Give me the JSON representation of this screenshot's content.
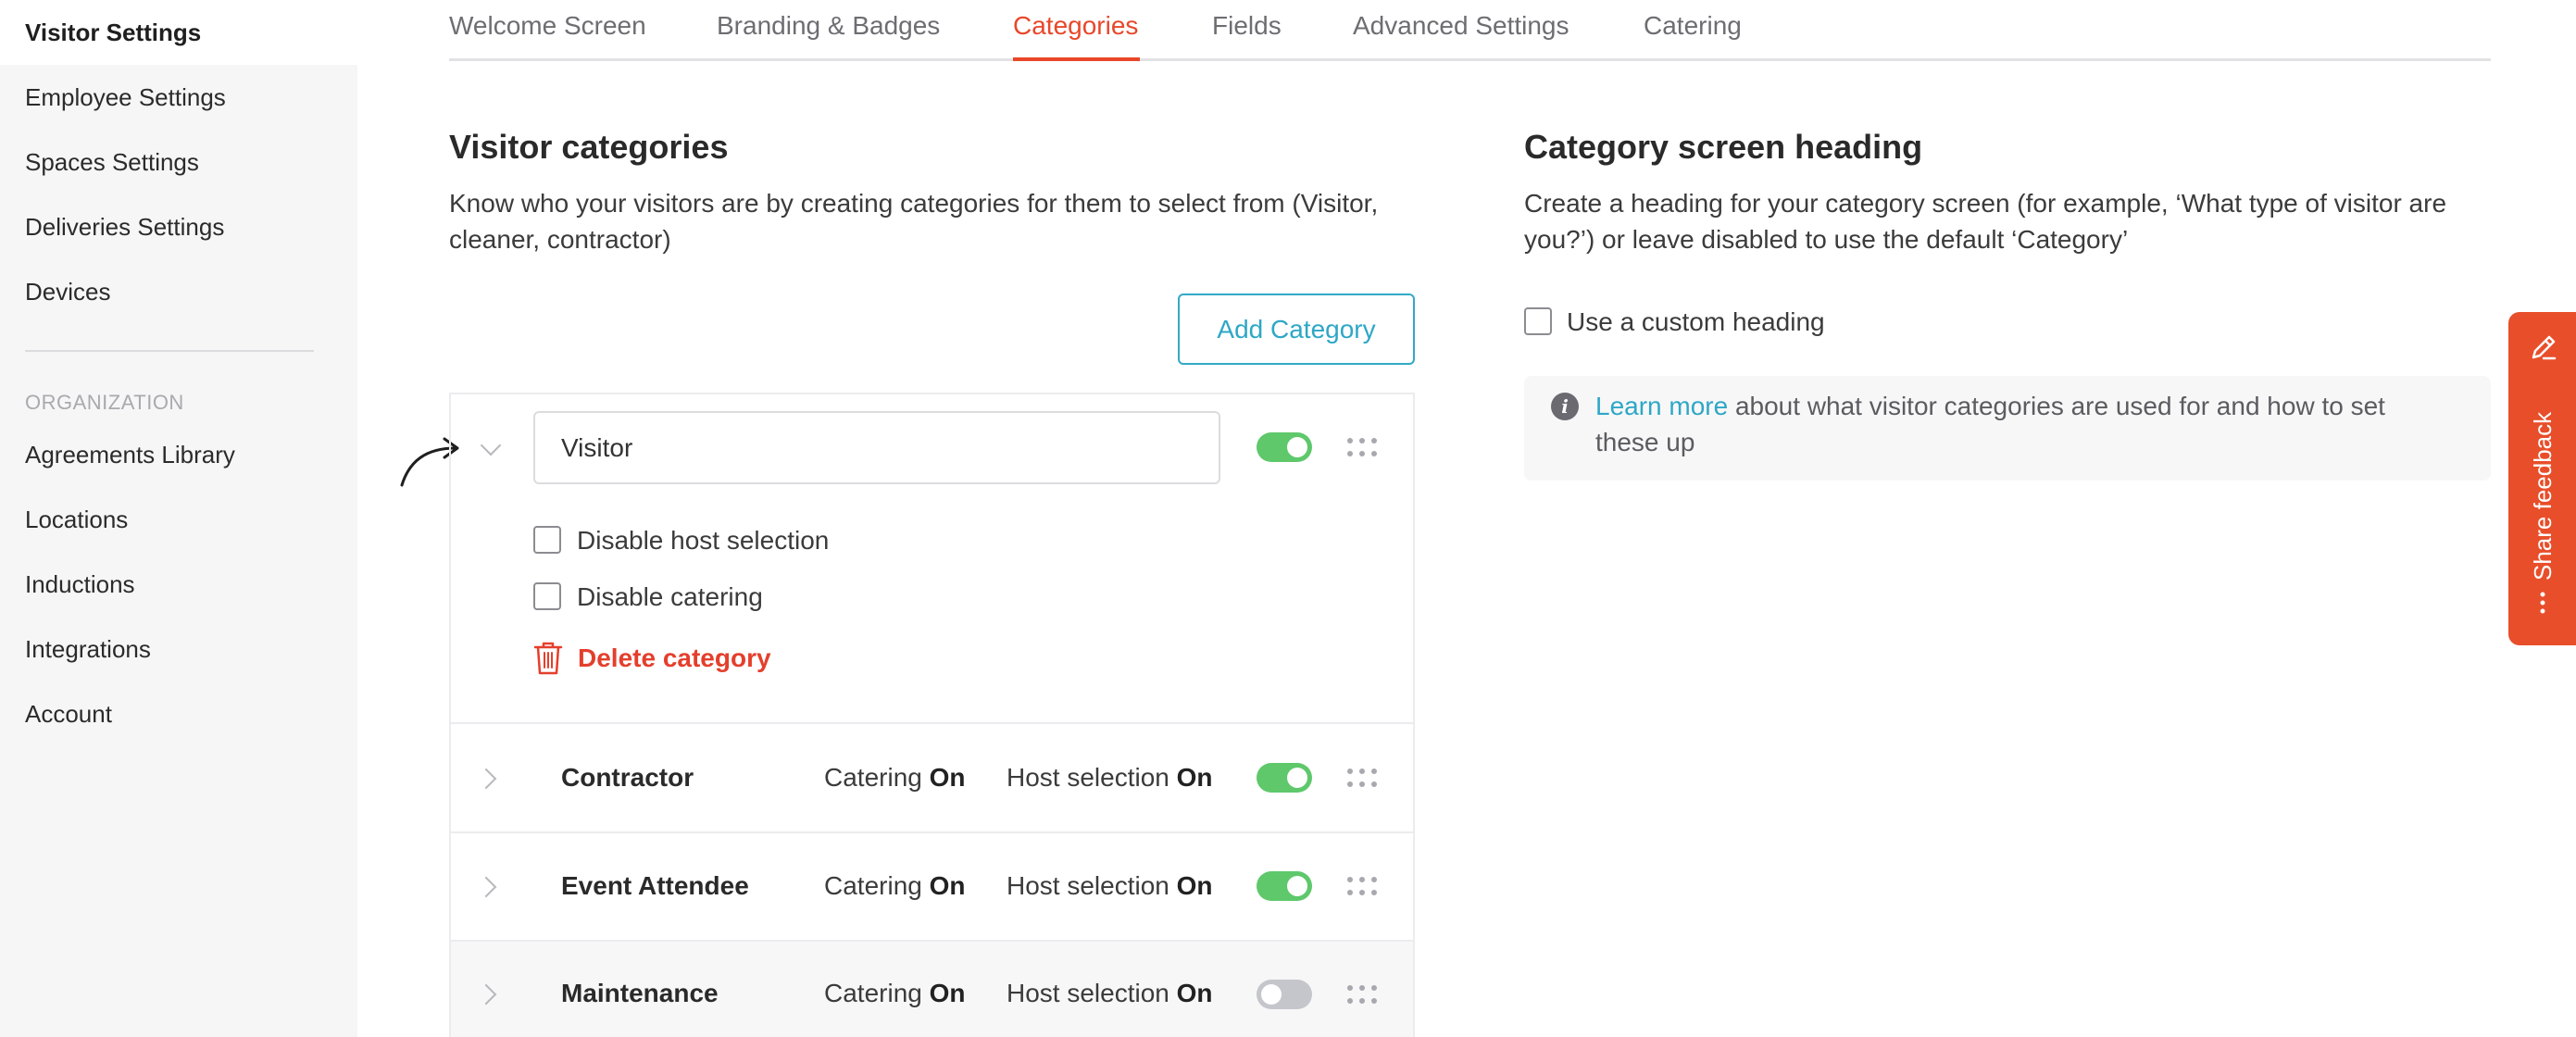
{
  "sidebar": {
    "active": "Visitor Settings",
    "items": [
      "Employee Settings",
      "Spaces Settings",
      "Deliveries Settings",
      "Devices"
    ],
    "section_title": "ORGANIZATION",
    "org_items": [
      "Agreements Library",
      "Locations",
      "Inductions",
      "Integrations",
      "Account"
    ]
  },
  "tabs": [
    "Welcome Screen",
    "Branding & Badges",
    "Categories",
    "Fields",
    "Advanced Settings",
    "Catering"
  ],
  "active_tab": "Categories",
  "visitor_categories": {
    "title": "Visitor categories",
    "description": "Know who your visitors are by creating categories for them to select from (Visitor, cleaner, contractor)",
    "add_button": "Add Category",
    "expanded": {
      "name_value": "Visitor",
      "enabled": true,
      "disable_host_label": "Disable host selection",
      "disable_catering_label": "Disable catering",
      "delete_label": "Delete category"
    },
    "catering_label": "Catering",
    "host_label": "Host selection",
    "rows": [
      {
        "name": "Contractor",
        "catering": "On",
        "host": "On",
        "enabled": true
      },
      {
        "name": "Event Attendee",
        "catering": "On",
        "host": "On",
        "enabled": true
      },
      {
        "name": "Maintenance",
        "catering": "On",
        "host": "On",
        "enabled": false
      }
    ]
  },
  "category_heading": {
    "title": "Category screen heading",
    "description": "Create a heading for your category screen (for example, ‘What type of visitor are you?’) or leave disabled to use the default ‘Category’",
    "custom_heading_label": "Use a custom heading",
    "info_link": "Learn more",
    "info_text": " about what visitor categories are used for and how to set these up"
  },
  "feedback": {
    "label": "Share feedback"
  },
  "colors": {
    "accent": "#e8472a",
    "link": "#2ea7c6",
    "toggle_on": "#5ec86b",
    "toggle_off": "#c5c6cb",
    "feedback_bg": "#e84e2a"
  }
}
